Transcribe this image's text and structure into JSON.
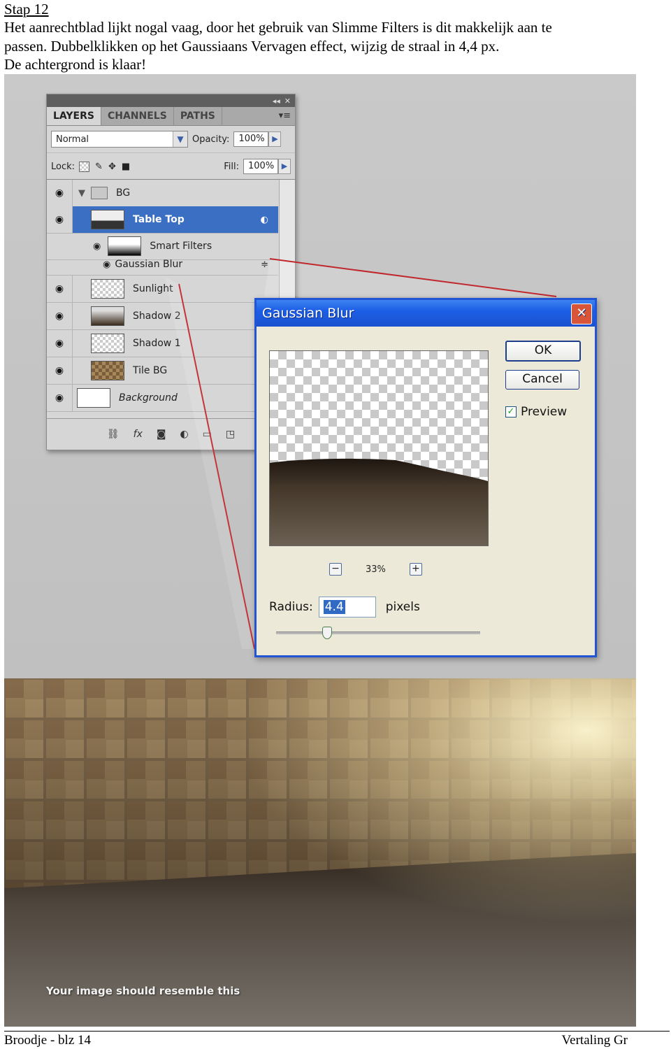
{
  "document": {
    "step_title": "Stap 12",
    "paragraph_lines": [
      "Het aanrechtblad lijkt nogal vaag, door het gebruik van Slimme Filters is dit makkelijk aan te",
      "passen. Dubbelklikken op het Gaussiaans Vervagen effect, wijzig de straal in 4,4 px.",
      "De achtergrond is klaar!"
    ],
    "footer_left": "Broodje - blz 14",
    "footer_right": "Vertaling Gr"
  },
  "layers_panel": {
    "tabs": [
      "LAYERS",
      "CHANNELS",
      "PATHS"
    ],
    "blend_mode": "Normal",
    "opacity_label": "Opacity:",
    "opacity_value": "100%",
    "lock_label": "Lock:",
    "fill_label": "Fill:",
    "fill_value": "100%",
    "group_name": "BG",
    "selected_layer": "Table Top",
    "smart_filters_label": "Smart Filters",
    "filter_name": "Gaussian Blur",
    "layers": [
      "Sunlight",
      "Shadow 2",
      "Shadow 1",
      "Tile BG",
      "Background"
    ]
  },
  "gaussian_dialog": {
    "title": "Gaussian Blur",
    "ok_label": "OK",
    "cancel_label": "Cancel",
    "preview_label": "Preview",
    "preview_checked": true,
    "zoom_value": "33%",
    "radius_label": "Radius:",
    "radius_value": "4.4",
    "radius_unit": "pixels"
  },
  "result_caption": "Your image should resemble this",
  "colors": {
    "selection_blue": "#3b6fc3",
    "xp_title_blue": "#1d5ee6",
    "connector_red": "#c0282e"
  }
}
